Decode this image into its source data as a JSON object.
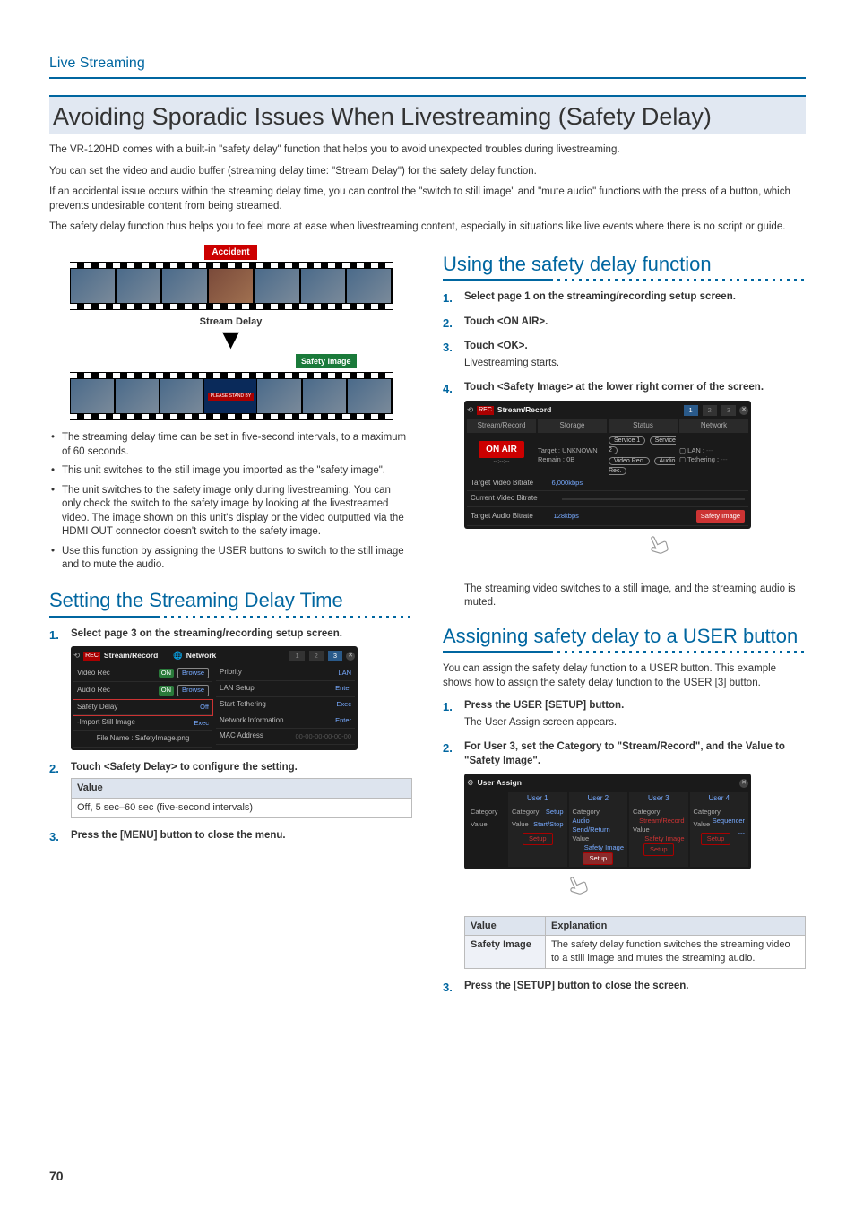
{
  "breadcrumb": "Live Streaming",
  "page_title": "Avoiding Sporadic Issues When Livestreaming (Safety Delay)",
  "intro": [
    "The VR-120HD comes with a built-in \"safety delay\" function that helps you to avoid unexpected troubles during livestreaming.",
    "You can set the video and audio buffer (streaming delay time: \"Stream Delay\") for the safety delay function.",
    "If an accidental issue occurs within the streaming delay time, you can control the \"switch to still image\" and \"mute audio\" functions with the press of a button, which prevents undesirable content from being streamed.",
    "The safety delay function thus helps you to feel more at ease when livestreaming content, especially in situations like live events where there is no script or guide."
  ],
  "diagram": {
    "accident_label": "Accident",
    "stream_delay_label": "Stream Delay",
    "safety_image_label": "Safety Image",
    "standby_text": "PLEASE STAND BY"
  },
  "bullets_left": [
    "The streaming delay time can be set in five-second intervals, to a maximum of 60 seconds.",
    "This unit switches to the still image you imported as the \"safety image\".",
    "The unit switches to the safety image only during livestreaming. You can only check the switch to the safety image by looking at the livestreamed video. The image shown on this unit's display or the video outputted via the HDMI OUT connector doesn't switch to the safety image.",
    "Use this function by assigning the USER buttons to switch to the still image and to mute the audio."
  ],
  "left_section": {
    "heading": "Setting the Streaming Delay Time",
    "steps": [
      {
        "title": "Select page 3 on the streaming/recording setup screen."
      },
      {
        "title": "Touch <Safety Delay> to configure the setting."
      },
      {
        "title": "Press the [MENU] button to close the menu."
      }
    ],
    "value_table_header": "Value",
    "value_table_row": "Off, 5 sec–60 sec (five-second intervals)",
    "screenshot": {
      "title": "Stream/Record",
      "pages": [
        "1",
        "2",
        "3"
      ],
      "active_page": "3",
      "left_hdr": "Stream/Record",
      "right_hdr": "Network",
      "left_rows": [
        {
          "lbl": "Video Rec",
          "tog": "ON",
          "btn": "Browse"
        },
        {
          "lbl": "Audio Rec",
          "tog": "ON",
          "btn": "Browse"
        },
        {
          "lbl": "Safety Delay",
          "val": "Off",
          "active": true
        },
        {
          "lbl": "-Import Still Image",
          "val": "Exec"
        },
        {
          "lbl": "File Name : SafetyImage.png",
          "val": ""
        }
      ],
      "right_rows": [
        {
          "lbl": "Priority",
          "val": "LAN"
        },
        {
          "lbl": "LAN Setup",
          "val": "Enter"
        },
        {
          "lbl": "Start Tethering",
          "val": "Exec"
        },
        {
          "lbl": "Network Information",
          "val": "Enter"
        },
        {
          "lbl": "MAC Address",
          "val": "00-00-00-00-00-00"
        }
      ]
    }
  },
  "right_section_1": {
    "heading": "Using the safety delay function",
    "steps": [
      {
        "title": "Select page 1 on the streaming/recording setup screen."
      },
      {
        "title": "Touch <ON AIR>."
      },
      {
        "title": "Touch <OK>.",
        "note": "Livestreaming starts."
      },
      {
        "title": "Touch <Safety Image> at the lower right corner of the screen."
      }
    ],
    "after_note": "The streaming video switches to a still image, and the streaming audio is muted.",
    "screenshot": {
      "title": "Stream/Record",
      "pages": [
        "1",
        "2",
        "3"
      ],
      "active_page": "1",
      "cols": [
        "Stream/Record",
        "Storage",
        "Status",
        "Network"
      ],
      "onair": "ON AIR",
      "timer": "--:--:--",
      "storage1": "Target : UNKNOWN",
      "storage2": "Remain : 0B",
      "status": [
        "Service 1",
        "Service 2",
        "Video Rec.",
        "Audio Rec."
      ],
      "net1": "LAN :",
      "net2": "Tethering :",
      "rows": [
        {
          "lbl": "Target Video Bitrate",
          "val": "6,000kbps"
        },
        {
          "lbl": "Current Video Bitrate",
          "val": ""
        },
        {
          "lbl": "Target Audio Bitrate",
          "val": "128kbps"
        }
      ],
      "safety_btn": "Safety Image"
    }
  },
  "right_section_2": {
    "heading": "Assigning safety delay to a USER button",
    "body": "You can assign the safety delay function to a USER button. This example shows how to assign the safety delay function to the USER [3] button.",
    "steps": [
      {
        "title": "Press the USER [SETUP] button.",
        "note": "The User Assign screen appears."
      },
      {
        "title": "For User 3, set the Category to \"Stream/Record\", and the Value to \"Safety Image\"."
      },
      {
        "title": "Press the [SETUP] button to close the screen."
      }
    ],
    "screenshot": {
      "title": "User Assign",
      "users": [
        "User 1",
        "User 2",
        "User 3",
        "User 4"
      ],
      "rows": [
        "Category",
        "Value"
      ],
      "cells": [
        {
          "cat": "Setup",
          "val": "Start/Stop"
        },
        {
          "cat": "Audio Send/Return",
          "val": "Safety Image"
        },
        {
          "cat": "Stream/Record",
          "val": "Safety Image"
        },
        {
          "cat": "Sequencer",
          "val": "---"
        }
      ],
      "setup_btn": "Setup"
    },
    "explain_table": {
      "h1": "Value",
      "h2": "Explanation",
      "key": "Safety Image",
      "exp": "The safety delay function switches the streaming video to a still image and mutes the streaming audio."
    }
  },
  "page_number": "70"
}
